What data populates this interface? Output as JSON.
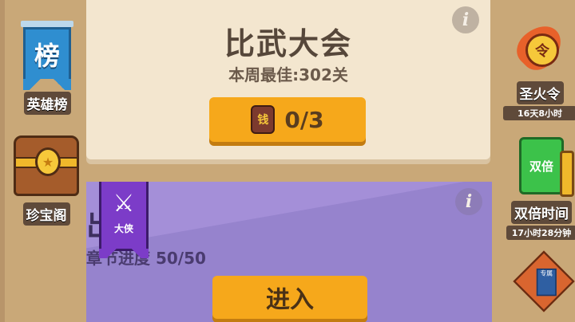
{
  "left_menu": {
    "leaderboard": {
      "icon_char": "榜",
      "label": "英雄榜"
    },
    "treasure": {
      "label": "珍宝阁"
    }
  },
  "right_menu": {
    "holy_fire": {
      "icon_char": "令",
      "label": "圣火令",
      "timer": "16天8小时"
    },
    "double_time": {
      "icon_text": "双倍",
      "label": "双倍时间",
      "timer": "17小时28分钟"
    },
    "exclusive": {
      "icon_text": "专属"
    }
  },
  "tournament": {
    "title": "比武大会",
    "best_record": "本周最佳:302关",
    "coin_char": "钱",
    "attempts": "0/3"
  },
  "adventure": {
    "title": "出山",
    "progress": "章节进度 50/50",
    "rank_badge": "大侠",
    "enter_label": "进入"
  },
  "colors": {
    "background": "#c9a878",
    "panel_cream": "#f3e6cf",
    "panel_purple": "#a48fd8",
    "button_orange": "#f6a81b"
  },
  "icons": {
    "info": "info-icon",
    "coin": "coin-icon",
    "swords": "crossed-swords-icon",
    "chest": "treasure-chest-icon",
    "fire": "flame-icon",
    "book": "book-icon"
  }
}
